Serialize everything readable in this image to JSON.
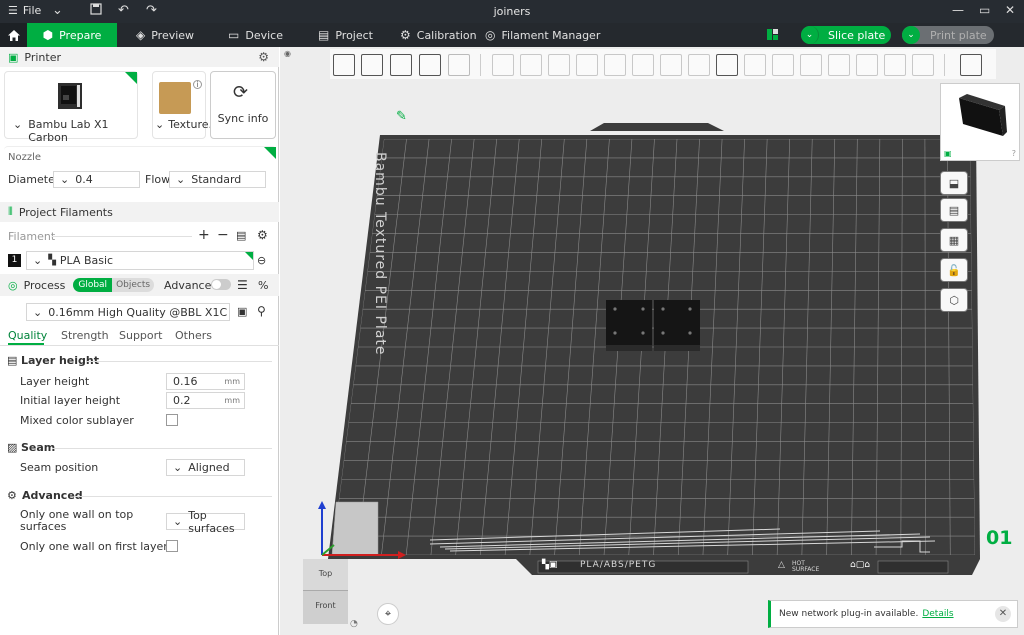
{
  "titlebar": {
    "menu_label": "File",
    "title": "joiners"
  },
  "nav": {
    "tabs": [
      {
        "label": "Prepare",
        "icon": "cube-icon"
      },
      {
        "label": "Preview",
        "icon": "layers-icon"
      },
      {
        "label": "Device",
        "icon": "monitor-icon"
      },
      {
        "label": "Project",
        "icon": "document-icon"
      },
      {
        "label": "Calibration",
        "icon": "settings-icon"
      },
      {
        "label": "Filament Manager",
        "icon": "spool-icon"
      }
    ],
    "slice_label": "Slice plate",
    "print_label": "Print plate"
  },
  "printer": {
    "header": "Printer",
    "name": "Bambu Lab X1 Carbon",
    "plate": "Texture...",
    "sync_label": "Sync info",
    "nozzle_label": "Nozzle",
    "diameter_label": "Diameter",
    "diameter_value": "0.4",
    "flow_label": "Flow",
    "flow_value": "Standard"
  },
  "filaments": {
    "header": "Project Filaments",
    "filament_label": "Filament",
    "items": [
      {
        "index": "1",
        "name": "PLA Basic"
      }
    ]
  },
  "process": {
    "header": "Process",
    "toggle_global": "Global",
    "toggle_objects": "Objects",
    "advanced_label": "Advanced",
    "advanced_on": false,
    "preset": "0.16mm High Quality @BBL X1C",
    "tabs": [
      "Quality",
      "Strength",
      "Support",
      "Others"
    ],
    "active_tab": "Quality",
    "groups": {
      "layer_height": {
        "title": "Layer height",
        "layer_height_label": "Layer height",
        "layer_height_value": "0.16",
        "initial_layer_label": "Initial layer height",
        "initial_layer_value": "0.2",
        "unit": "mm",
        "mixed_label": "Mixed color sublayer"
      },
      "seam": {
        "title": "Seam",
        "position_label": "Seam position",
        "position_value": "Aligned"
      },
      "advanced": {
        "title": "Advanced",
        "one_wall_top_label": "Only one wall on top surfaces",
        "one_wall_top_value": "Top surfaces",
        "one_wall_first_label": "Only one wall on first layer"
      }
    }
  },
  "viewport": {
    "bed_label": "Bambu Textured PEI Plate",
    "bed_material": "PLA/ABS/PETG",
    "hot_surface": "HOT SURFACE",
    "plate_number": "01",
    "view_top": "Top",
    "view_front": "Front",
    "notification_text": "New network plug-in available.",
    "notification_link": "Details"
  },
  "colors": {
    "accent": "#00ae42",
    "titlebar": "#272c32",
    "navbar": "#25292e",
    "bed": "#3c3c3c",
    "viewport_bg": "#ededed"
  }
}
